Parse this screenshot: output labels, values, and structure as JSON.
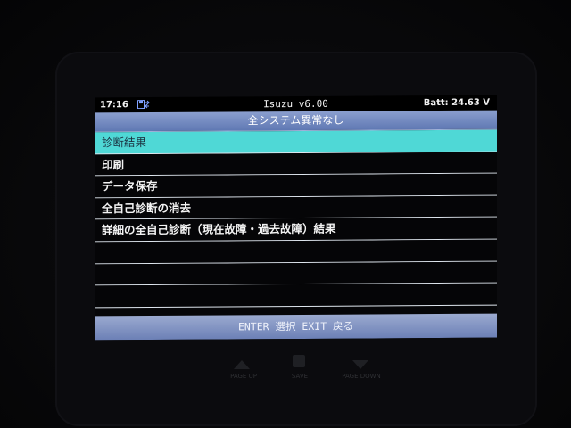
{
  "statusbar": {
    "time": "17:16",
    "storage_icon": "disk-icon",
    "title": "Isuzu v6.00",
    "battery": "Batt: 24.63 V"
  },
  "header": {
    "title": "全システム異常なし"
  },
  "menu": {
    "items": [
      {
        "label": "診断結果",
        "selected": true
      },
      {
        "label": "印刷"
      },
      {
        "label": "データ保存"
      },
      {
        "label": "全自己診断の消去"
      },
      {
        "label": "詳細の全自己診断（現在故障・過去故障）結果"
      },
      {
        "label": ""
      },
      {
        "label": ""
      },
      {
        "label": ""
      }
    ]
  },
  "footer": {
    "hint": "ENTER 選択 EXIT 戻る"
  },
  "hardware_keys": {
    "page_up": "PAGE UP",
    "save": "SAVE",
    "page_down": "PAGE DOWN"
  },
  "colors": {
    "selection": "#4fd8d6",
    "title_bar": "#7088c0",
    "footer_bar": "#8292c3"
  }
}
